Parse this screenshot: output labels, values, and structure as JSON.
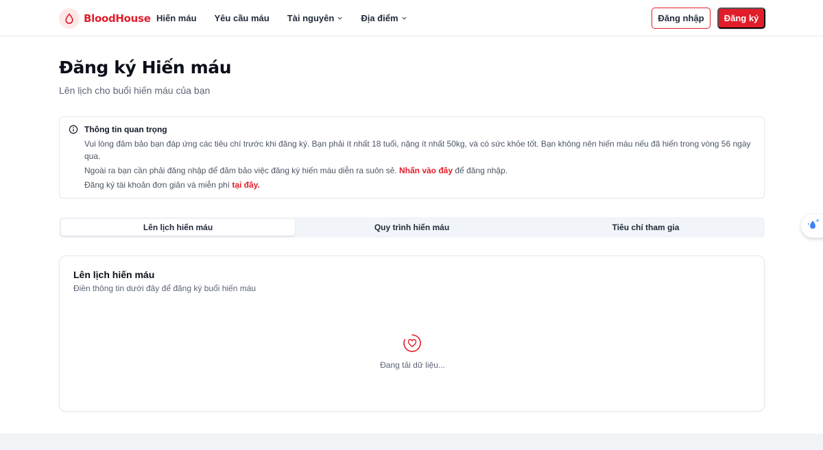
{
  "brand": {
    "name": "BloodHouse",
    "logo_icon": "blood-drop-icon",
    "color": "#e11d2a"
  },
  "nav": {
    "items": [
      {
        "label": "Hiến máu",
        "has_dropdown": false
      },
      {
        "label": "Yêu cầu máu",
        "has_dropdown": false
      },
      {
        "label": "Tài nguyên",
        "has_dropdown": true
      },
      {
        "label": "Địa điểm",
        "has_dropdown": true
      }
    ],
    "login_label": "Đăng nhập",
    "register_label": "Đăng ký"
  },
  "page": {
    "title": "Đăng ký Hiến máu",
    "subtitle": "Lên lịch cho buổi hiến máu của bạn"
  },
  "info": {
    "icon": "info-circle-icon",
    "title": "Thông tin quan trọng",
    "line1": "Vui lòng đảm bảo bạn đáp ứng các tiêu chí trước khi đăng ký. Bạn phải ít nhất 18 tuổi, nặng ít nhất 50kg, và có sức khỏe tốt. Bạn không nên hiến máu nếu đã hiến trong vòng 56 ngày qua.",
    "line2_prefix": "Ngoài ra bạn cần phải đăng nhập để đảm bảo việc đăng ký hiến máu diễn ra suôn sẻ.",
    "line2_link": "Nhấn vào đây",
    "line2_suffix": "để đăng nhập.",
    "line3_prefix": "Đăng ký tài khoản đơn giản và miễn phí",
    "line3_link": "tại đây."
  },
  "tabs": [
    {
      "label": "Lên lịch hiến máu",
      "active": true
    },
    {
      "label": "Quy trình hiến máu",
      "active": false
    },
    {
      "label": "Tiêu chí tham gia",
      "active": false
    }
  ],
  "card": {
    "title": "Lên lịch hiến máu",
    "description": "Điền thông tin dưới đây để đăng ký buổi hiến máu",
    "loading_icon": "heart-spinner-icon",
    "loading_text": "Đang tải dữ liệu..."
  },
  "widget": {
    "icon": "water-drop-sparkle-icon"
  }
}
